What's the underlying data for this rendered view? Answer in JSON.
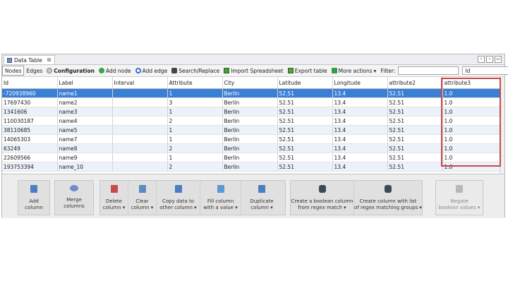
{
  "tab": {
    "title": "Data Table",
    "close": "⊠"
  },
  "window_buttons": [
    "‹",
    "›",
    "▭"
  ],
  "toolbar": {
    "nodes": "Nodes",
    "edges": "Edges",
    "configuration": "Configuration",
    "add_node": "Add node",
    "add_edge": "Add edge",
    "search_replace": "Search/Replace",
    "import_spreadsheet": "Import Spreadsheet",
    "export_table": "Export table",
    "more_actions": "More actions",
    "filter_label": "Filter:",
    "column_select": "Id",
    "accent_blue": "#3a7fd6"
  },
  "table": {
    "columns": [
      "Id",
      "Label",
      "Interval",
      "Attribute",
      "City",
      "Latitude",
      "Longitude",
      "attribute2",
      "attribute3"
    ],
    "rows": [
      [
        "-720938960",
        "name1",
        "",
        "1",
        "Berlin",
        "52.51",
        "13.4",
        "52.51",
        "1.0"
      ],
      [
        "17697430",
        "name2",
        "",
        "3",
        "Berlin",
        "52.51",
        "13.4",
        "52.51",
        "1.0"
      ],
      [
        "1341606",
        "name3",
        "",
        "1",
        "Berlin",
        "52.51",
        "13.4",
        "52.51",
        "1.0"
      ],
      [
        "110030187",
        "name4",
        "",
        "2",
        "Berlin",
        "52.51",
        "13.4",
        "52.51",
        "1.0"
      ],
      [
        "38110685",
        "name5",
        "",
        "1",
        "Berlin",
        "52.51",
        "13.4",
        "52.51",
        "1.0"
      ],
      [
        "14065303",
        "name7",
        "",
        "1",
        "Berlin",
        "52.51",
        "13.4",
        "52.51",
        "1.0"
      ],
      [
        "63249",
        "name8",
        "",
        "2",
        "Berlin",
        "52.51",
        "13.4",
        "52.51",
        "1.0"
      ],
      [
        "22609566",
        "name9",
        "",
        "1",
        "Berlin",
        "52.51",
        "13.4",
        "52.51",
        "1.0"
      ],
      [
        "193753394",
        "name_10",
        "",
        "2",
        "Berlin",
        "52.51",
        "13.4",
        "52.51",
        "1.0"
      ]
    ]
  },
  "actions": {
    "add_column": "Add\ncolumn",
    "merge_columns": "Merge\ncolumns",
    "delete_column": "Delete\ncolumn ▾",
    "clear_column": "Clear\ncolumn ▾",
    "copy_data": "Copy data to\nother column ▾",
    "fill_column": "Fill column\nwith a value ▾",
    "duplicate_column": "Duplicate\ncolumn ▾",
    "create_boolean": "Create a boolean column\nfrom regex match ▾",
    "create_list": "Create column with list\nof regex matching groups ▾",
    "negate_boolean": "Negate\nboolean values ▾"
  },
  "highlight_color": "#c84848"
}
